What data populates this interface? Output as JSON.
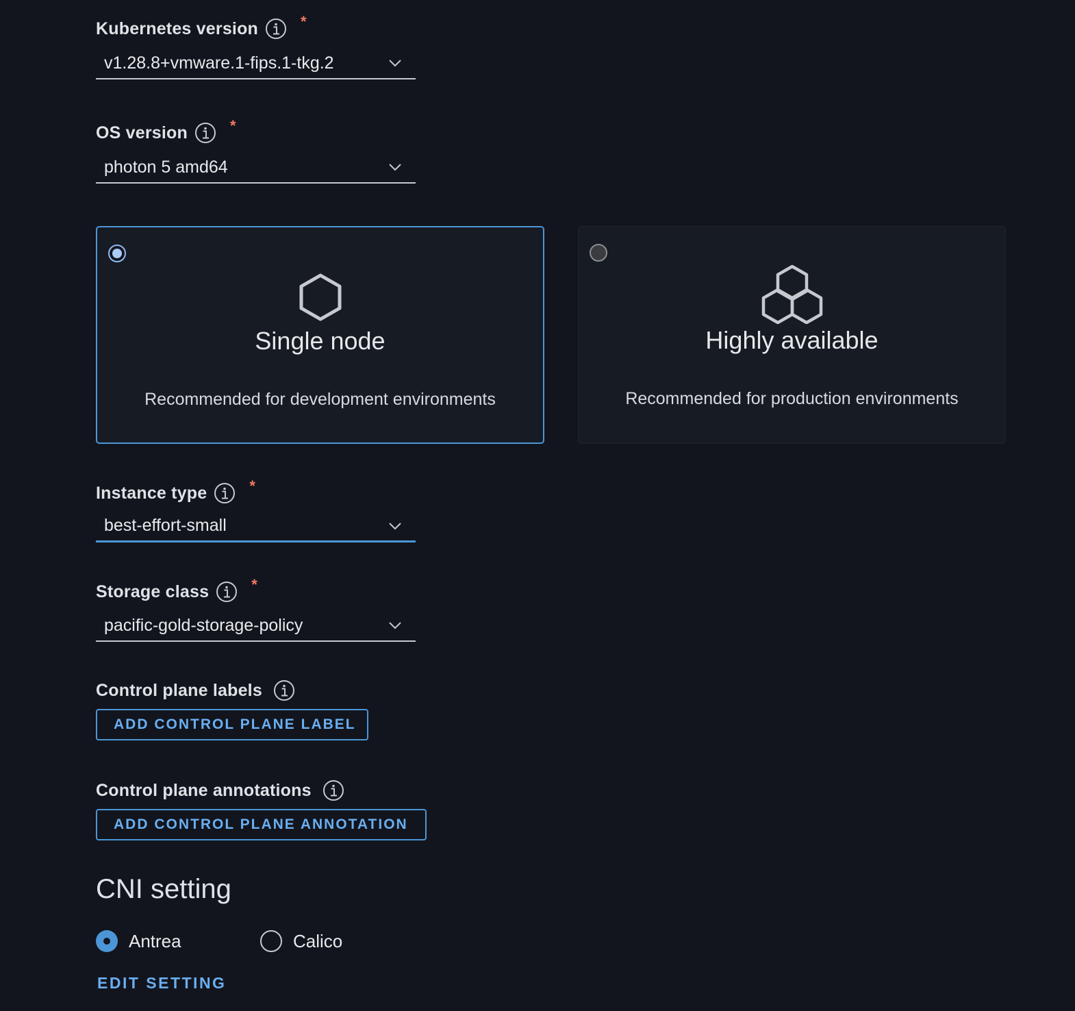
{
  "kubernetes_version": {
    "label": "Kubernetes version",
    "required_mark": "*",
    "value": "v1.28.8+vmware.1-fips.1-tkg.2"
  },
  "os_version": {
    "label": "OS version",
    "required_mark": "*",
    "value": "photon 5 amd64"
  },
  "topology": {
    "options": [
      {
        "title": "Single node",
        "description": "Recommended for development environments",
        "selected": true
      },
      {
        "title": "Highly available",
        "description": "Recommended for production environments",
        "selected": false
      }
    ]
  },
  "instance_type": {
    "label": "Instance type",
    "required_mark": "*",
    "value": "best-effort-small"
  },
  "storage_class": {
    "label": "Storage class",
    "required_mark": "*",
    "value": "pacific-gold-storage-policy"
  },
  "control_plane_labels": {
    "label": "Control plane labels",
    "button": "ADD CONTROL PLANE LABEL"
  },
  "control_plane_annotations": {
    "label": "Control plane annotations",
    "button": "ADD CONTROL PLANE ANNOTATION"
  },
  "cni": {
    "title": "CNI setting",
    "options": [
      {
        "label": "Antrea",
        "checked": true
      },
      {
        "label": "Calico",
        "checked": false
      }
    ],
    "edit_button": "EDIT SETTING"
  },
  "colors": {
    "background": "#12151d",
    "accent": "#4c96d7",
    "required": "#f27963"
  }
}
